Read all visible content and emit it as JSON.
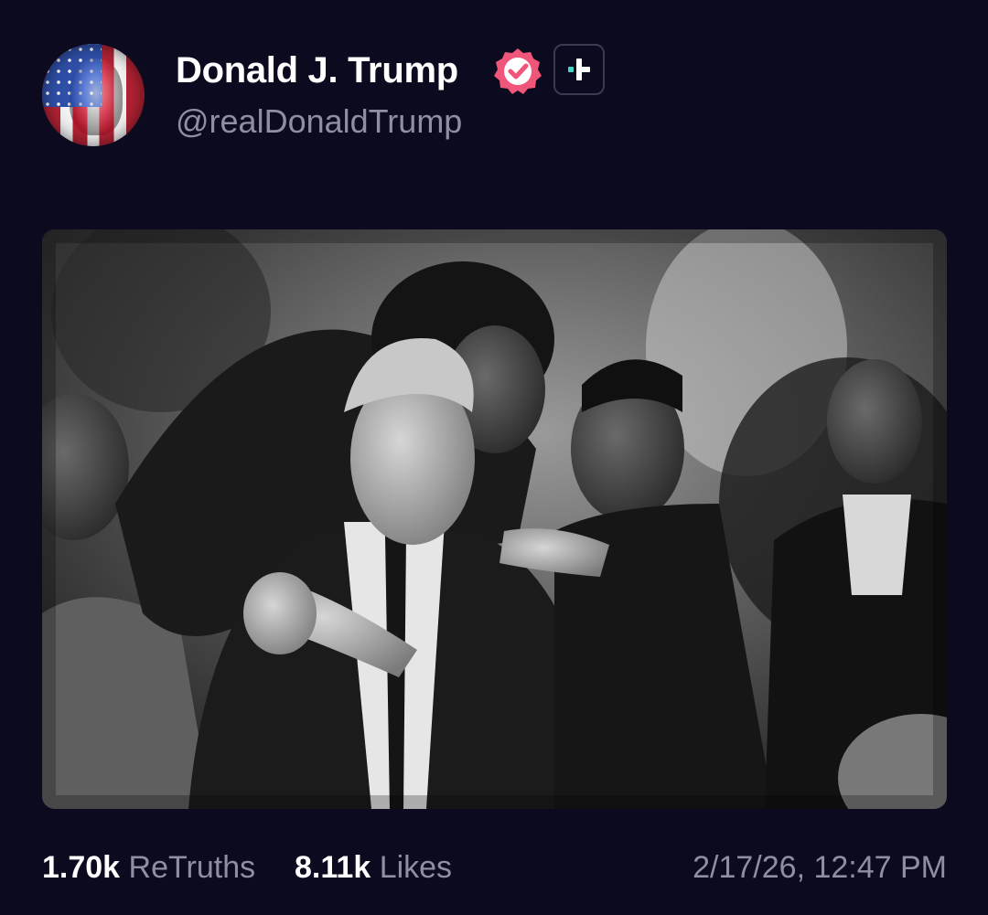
{
  "author": {
    "display_name": "Donald J. Trump",
    "handle": "@realDonaldTrump",
    "avatar_icon": "flag-portrait-avatar",
    "verified_icon": "verified-badge-icon",
    "verified_color": "#f0567a",
    "plus_icon": "truth-plus-icon",
    "plus_color": "#3fd6c4"
  },
  "media": {
    "type": "photo",
    "style": "black-and-white"
  },
  "stats": {
    "retruths_count": "1.70k",
    "retruths_label": "ReTruths",
    "likes_count": "8.11k",
    "likes_label": "Likes"
  },
  "timestamp": "2/17/26, 12:47 PM",
  "colors": {
    "background": "#0c0a1e",
    "primary_text": "#ffffff",
    "secondary_text": "#8f8ea3"
  }
}
